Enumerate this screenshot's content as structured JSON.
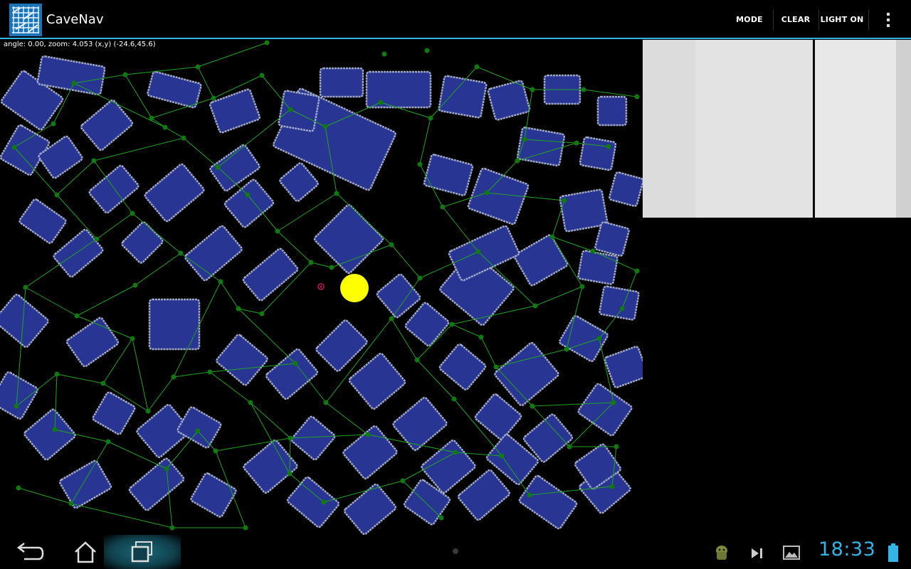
{
  "app": {
    "title": "CaveNav",
    "icon": "grid-map-icon"
  },
  "actions": {
    "mode_label": "MODE",
    "clear_label": "CLEAR",
    "light_label": "LIGHT ON",
    "overflow_icon": "overflow-menu-icon"
  },
  "map": {
    "status_text": "angle: 0.00, zoom: 4.053 (x,y) (-24.6,45.6)",
    "colors": {
      "background": "#000000",
      "block": "#283593",
      "block_border": "#9fa8c8",
      "graph": "#1fa51f",
      "node": "#0f7a0f",
      "player": "#ffff00",
      "target": "#c2185b"
    }
  },
  "sysbar": {
    "back_icon": "back-icon",
    "home_icon": "home-icon",
    "recents_icon": "recents-icon",
    "notification_icons": [
      "android-debug-icon",
      "media-next-icon",
      "gallery-icon"
    ],
    "clock": "18:33",
    "battery_icon": "battery-icon",
    "accent": "#33b5e5"
  }
}
